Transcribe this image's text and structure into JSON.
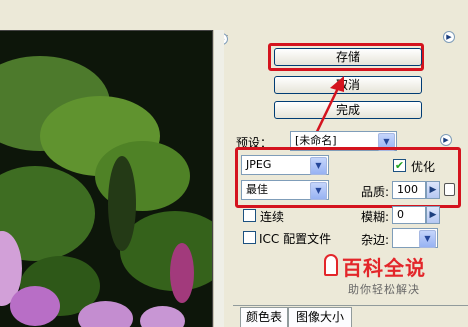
{
  "buttons": {
    "save": "存储",
    "cancel": "取消",
    "done": "完成"
  },
  "settings": {
    "preset_label": "预设：",
    "preset_value": "[未命名]",
    "format_value": "JPEG",
    "optimize_label": "优化",
    "quality_level": "最佳",
    "quality_label": "品质:",
    "quality_value": "100",
    "progressive_label": "连续",
    "blur_label": "模糊:",
    "blur_value": "0",
    "icc_label": "ICC 配置文件",
    "matte_label": "杂边:"
  },
  "tabs": [
    "颜色表",
    "图像大小"
  ],
  "watermark": {
    "title": "百科全说",
    "subtitle": "助你轻松解决"
  },
  "icons": {
    "panel_menu": "right-arrow-circle-icon",
    "slider": "right-triangle-icon",
    "dropdown": "chevron-down-icon"
  },
  "colors": {
    "highlight": "#d4131e",
    "dialog_bg": "#ece9d8",
    "watermark_red": "#e3262a"
  }
}
